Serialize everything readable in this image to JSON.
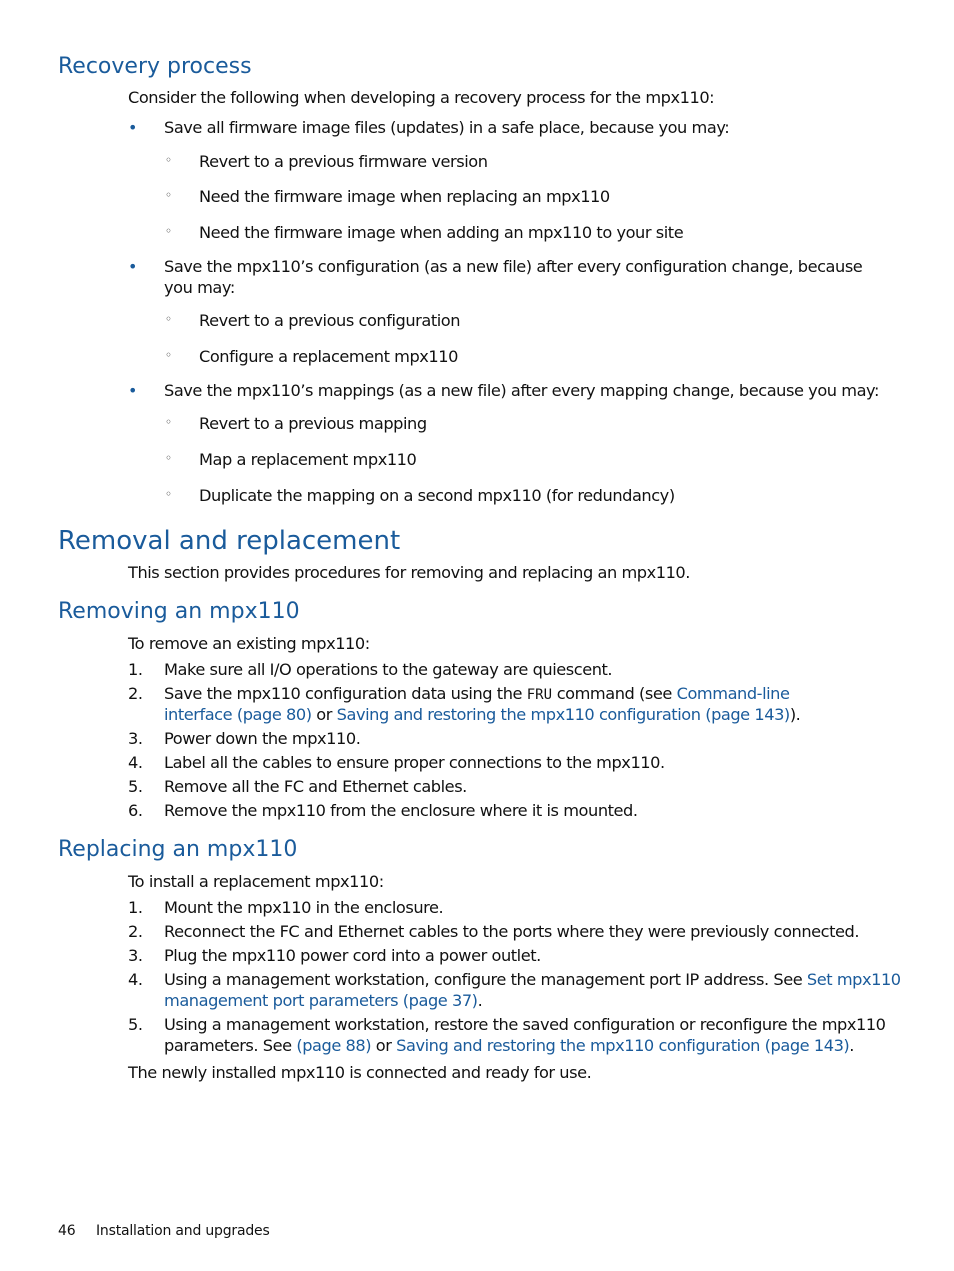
{
  "recovery": {
    "heading": "Recovery process",
    "intro": "Consider the following when developing a recovery process for the mpx110:",
    "bullets": [
      {
        "text": "Save all firmware image files (updates) in a safe place, because you may:",
        "sub": [
          "Revert to a previous firmware version",
          "Need the firmware image when replacing an mpx110",
          "Need the firmware image when adding an mpx110 to your site"
        ]
      },
      {
        "text_line1": "Save the mpx110’s configuration (as a new file) after every configuration change, because",
        "text_line2": "you may:",
        "sub": [
          "Revert to a previous configuration",
          "Configure a replacement mpx110"
        ]
      },
      {
        "text": "Save the mpx110’s mappings (as a new file) after every mapping change, because you may:",
        "sub": [
          "Revert to a previous mapping",
          "Map a replacement mpx110",
          "Duplicate the mapping on a second mpx110 (for redundancy)"
        ]
      }
    ],
    "bullet_glyph": "•",
    "sub_glyph": "◦"
  },
  "removal_replacement": {
    "heading": "Removal and replacement",
    "intro": "This section provides procedures for removing and replacing an mpx110."
  },
  "removing": {
    "heading": "Removing an mpx110",
    "intro": "To remove an existing mpx110:",
    "steps": [
      {
        "num": "1.",
        "text": "Make sure all I/O operations to the gateway are quiescent."
      },
      {
        "num": "2.",
        "pre": "Save the mpx110 configuration data using the ",
        "code": "FRU",
        "mid": " command (see ",
        "link1_line1": "Command-line",
        "link1_line2": "interface (page 80)",
        "or": " or ",
        "link2": "Saving and restoring the mpx110 configuration (page 143)",
        "post": ")."
      },
      {
        "num": "3.",
        "text": "Power down the mpx110."
      },
      {
        "num": "4.",
        "text": "Label all the cables to ensure proper connections to the mpx110."
      },
      {
        "num": "5.",
        "text": "Remove all the FC and Ethernet cables."
      },
      {
        "num": "6.",
        "text": "Remove the mpx110 from the enclosure where it is mounted."
      }
    ]
  },
  "replacing": {
    "heading": "Replacing an mpx110",
    "intro": "To install a replacement mpx110:",
    "steps": [
      {
        "num": "1.",
        "text": "Mount the mpx110 in the enclosure."
      },
      {
        "num": "2.",
        "text": "Reconnect the FC and Ethernet cables to the ports where they were previously connected."
      },
      {
        "num": "3.",
        "text": "Plug the mpx110 power cord into a power outlet."
      },
      {
        "num": "4.",
        "pre": "Using a management workstation, configure the management port IP address. See ",
        "link1_line1": "Set mpx110",
        "link1_line2": "management port parameters (page 37)",
        "post": "."
      },
      {
        "num": "5.",
        "line1": "Using a management workstation, restore the saved configuration or reconfigure the mpx110",
        "pre2": "parameters. See ",
        "link1": "(page 88)",
        "or": " or ",
        "link2": "Saving and restoring the mpx110 configuration (page 143)",
        "post": "."
      }
    ],
    "closing": "The newly installed mpx110 is connected and ready for use."
  },
  "footer": {
    "page_number": "46",
    "chapter": "Installation and upgrades"
  },
  "colors": {
    "heading": "#1a5b9b",
    "link": "#1a5b9b",
    "text": "#111111"
  }
}
